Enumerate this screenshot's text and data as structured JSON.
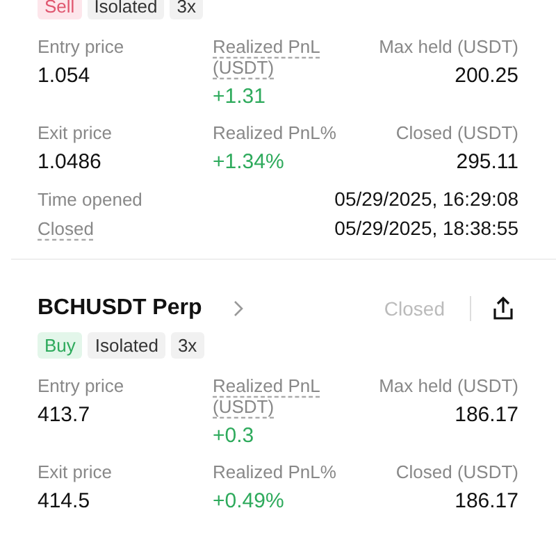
{
  "positions": [
    {
      "tags": [
        {
          "label": "Sell",
          "kind": "sell"
        },
        {
          "label": "Isolated",
          "kind": "neutral"
        },
        {
          "label": "3x",
          "kind": "neutral"
        }
      ],
      "stats": [
        {
          "label": "Entry price",
          "value": "1.054",
          "dashed": false,
          "positive": false
        },
        {
          "label": "Realized PnL (USDT)",
          "value": "+1.31",
          "dashed": true,
          "positive": true
        },
        {
          "label": "Max held (USDT)",
          "value": "200.25",
          "dashed": false,
          "positive": false
        },
        {
          "label": "Exit price",
          "value": "1.0486",
          "dashed": false,
          "positive": false
        },
        {
          "label": "Realized PnL%",
          "value": "+1.34%",
          "dashed": false,
          "positive": true
        },
        {
          "label": "Closed (USDT)",
          "value": "295.11",
          "dashed": false,
          "positive": false
        }
      ],
      "times": [
        {
          "label": "Time opened",
          "value": "05/29/2025, 16:29:08",
          "dashed": false
        },
        {
          "label": "Closed",
          "value": "05/29/2025, 18:38:55",
          "dashed": true
        }
      ]
    },
    {
      "symbol": "BCHUSDT Perp",
      "status": "Closed",
      "tags": [
        {
          "label": "Buy",
          "kind": "buy"
        },
        {
          "label": "Isolated",
          "kind": "neutral"
        },
        {
          "label": "3x",
          "kind": "neutral"
        }
      ],
      "stats": [
        {
          "label": "Entry price",
          "value": "413.7",
          "dashed": false,
          "positive": false
        },
        {
          "label": "Realized PnL (USDT)",
          "value": "+0.3",
          "dashed": true,
          "positive": true
        },
        {
          "label": "Max held (USDT)",
          "value": "186.17",
          "dashed": false,
          "positive": false
        },
        {
          "label": "Exit price",
          "value": "414.5",
          "dashed": false,
          "positive": false
        },
        {
          "label": "Realized PnL%",
          "value": "+0.49%",
          "dashed": false,
          "positive": true
        },
        {
          "label": "Closed (USDT)",
          "value": "186.17",
          "dashed": false,
          "positive": false
        }
      ]
    }
  ]
}
